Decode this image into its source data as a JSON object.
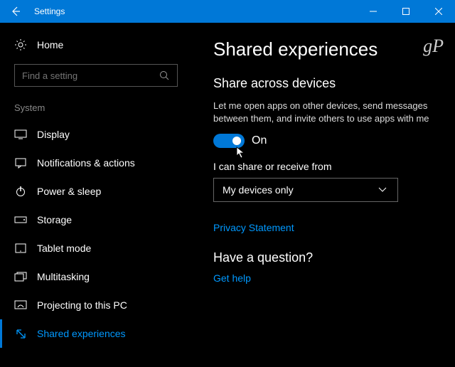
{
  "window": {
    "title": "Settings"
  },
  "watermark": "gP",
  "sidebar": {
    "home": "Home",
    "search_placeholder": "Find a setting",
    "group": "System",
    "items": [
      {
        "label": "Display"
      },
      {
        "label": "Notifications & actions"
      },
      {
        "label": "Power & sleep"
      },
      {
        "label": "Storage"
      },
      {
        "label": "Tablet mode"
      },
      {
        "label": "Multitasking"
      },
      {
        "label": "Projecting to this PC"
      },
      {
        "label": "Shared experiences"
      }
    ]
  },
  "main": {
    "title": "Shared experiences",
    "section1_title": "Share across devices",
    "section1_desc": "Let me open apps on other devices, send messages between them, and invite others to use apps with me",
    "toggle_state": "On",
    "share_from_label": "I can share or receive from",
    "share_from_value": "My devices only",
    "privacy_link": "Privacy Statement",
    "question_title": "Have a question?",
    "help_link": "Get help"
  }
}
